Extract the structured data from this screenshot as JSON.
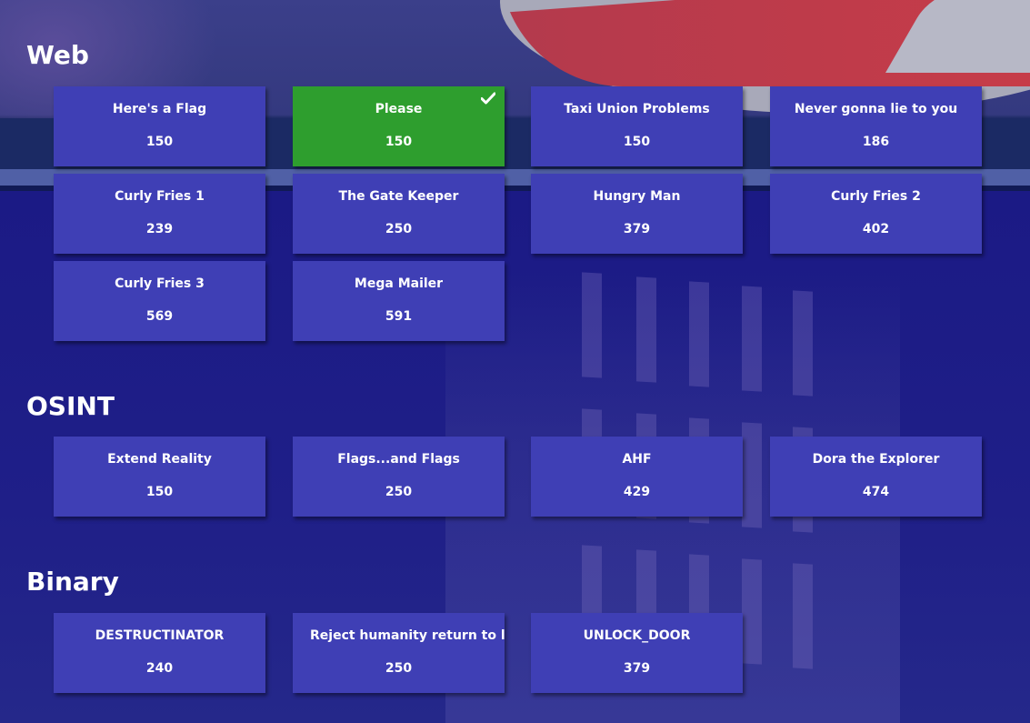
{
  "categories": [
    {
      "title": "Web",
      "challenges": [
        {
          "name": "Here's a Flag",
          "points": "150",
          "solved": false
        },
        {
          "name": "Please",
          "points": "150",
          "solved": true
        },
        {
          "name": "Taxi Union Problems",
          "points": "150",
          "solved": false
        },
        {
          "name": "Never gonna lie to you",
          "points": "186",
          "solved": false
        },
        {
          "name": "Curly Fries 1",
          "points": "239",
          "solved": false
        },
        {
          "name": "The Gate Keeper",
          "points": "250",
          "solved": false
        },
        {
          "name": "Hungry Man",
          "points": "379",
          "solved": false
        },
        {
          "name": "Curly Fries 2",
          "points": "402",
          "solved": false
        },
        {
          "name": "Curly Fries 3",
          "points": "569",
          "solved": false
        },
        {
          "name": "Mega Mailer",
          "points": "591",
          "solved": false
        }
      ]
    },
    {
      "title": "OSINT",
      "challenges": [
        {
          "name": "Extend Reality",
          "points": "150",
          "solved": false
        },
        {
          "name": "Flags...and Flags",
          "points": "250",
          "solved": false
        },
        {
          "name": "AHF",
          "points": "429",
          "solved": false
        },
        {
          "name": "Dora the Explorer",
          "points": "474",
          "solved": false
        }
      ]
    },
    {
      "title": "Binary",
      "challenges": [
        {
          "name": "DESTRUCTINATOR",
          "points": "240",
          "solved": false
        },
        {
          "name": "Reject humanity return to libc",
          "points": "250",
          "solved": false
        },
        {
          "name": "UNLOCK_DOOR",
          "points": "379",
          "solved": false
        }
      ]
    }
  ],
  "icons": {
    "solved": "check-icon"
  },
  "colors": {
    "tile": "#3f3fb5",
    "solved_tile": "#2e9e2e",
    "text": "#ffffff"
  }
}
